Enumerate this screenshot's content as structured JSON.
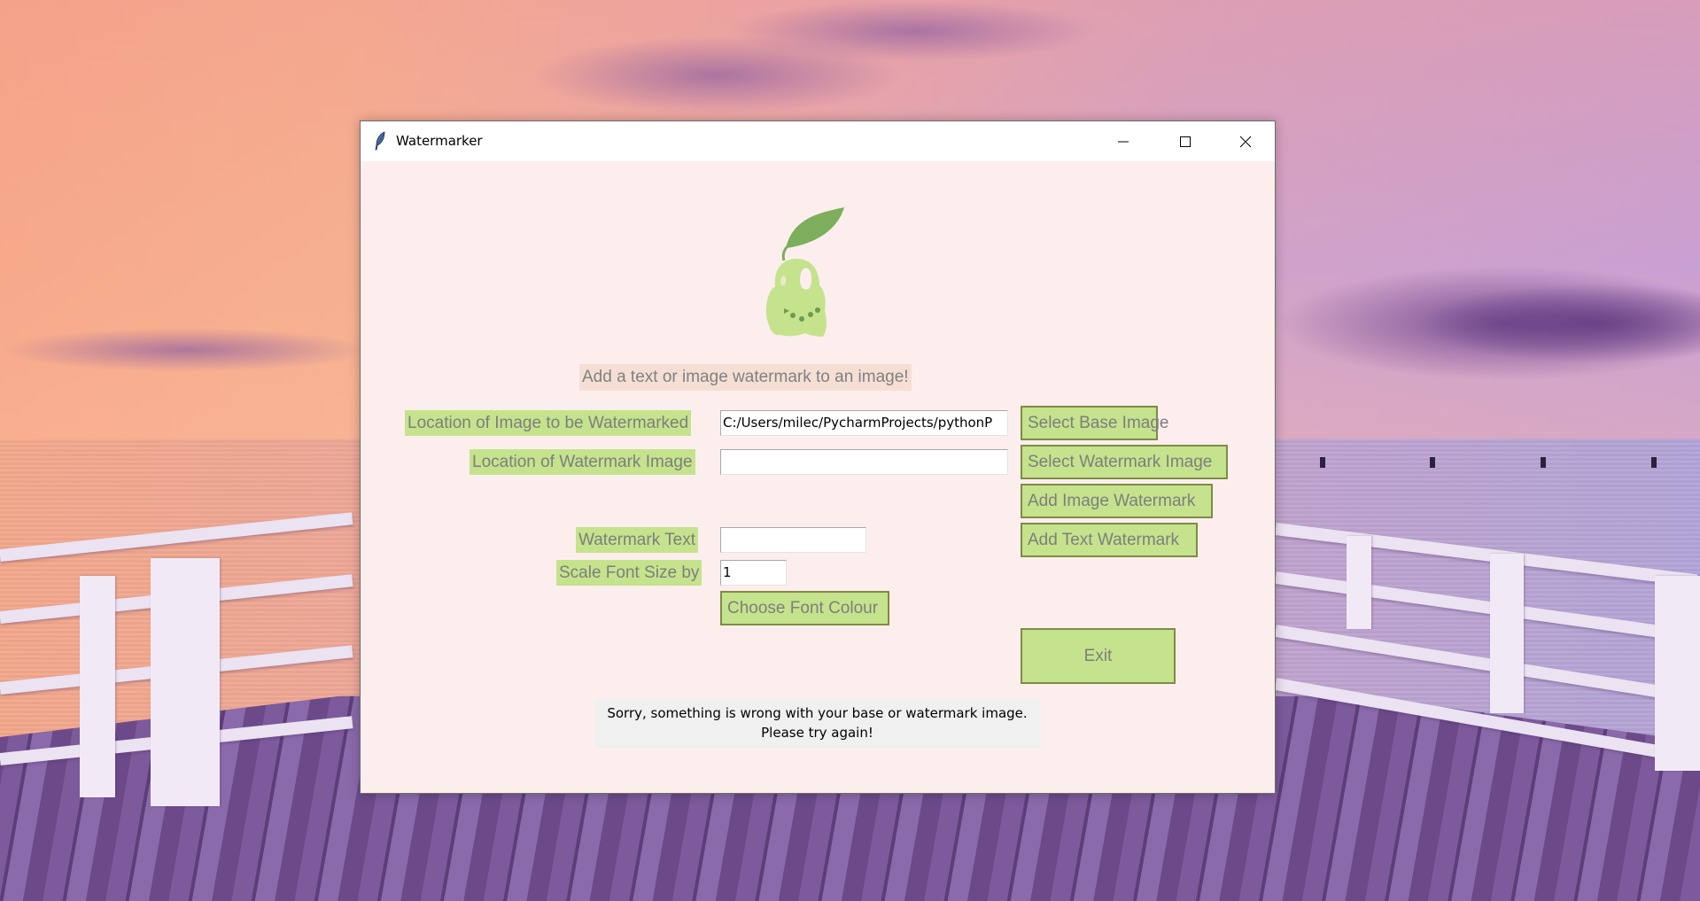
{
  "window": {
    "title": "Watermarker",
    "controls": {
      "minimize": "minimize",
      "maximize": "maximize",
      "close": "close"
    }
  },
  "header": {
    "subtitle": "Add a text or image watermark to an image!"
  },
  "form": {
    "base_image": {
      "label": "Location of Image to be Watermarked",
      "value": "C:/Users/milec/PycharmProjects/pythonP"
    },
    "watermark_image": {
      "label": "Location of Watermark Image",
      "value": ""
    },
    "watermark_text": {
      "label": "Watermark Text",
      "value": ""
    },
    "font_scale": {
      "label": "Scale Font Size by",
      "value": "1"
    }
  },
  "buttons": {
    "select_base": "Select Base Image",
    "select_watermark": "Select Watermark Image",
    "add_image_watermark": "Add Image Watermark",
    "add_text_watermark": "Add Text Watermark",
    "choose_font_colour": "Choose Font Colour",
    "exit": "Exit"
  },
  "status": {
    "line1": "Sorry, something is wrong with your base or watermark image.",
    "line2": "Please try again!"
  },
  "colors": {
    "window_bg": "#fdeeee",
    "accent_green": "#c5e38c",
    "label_text": "#7e7e7e",
    "subtitle_bg": "#f5dfd5",
    "error_bg": "#f0f0f0"
  }
}
